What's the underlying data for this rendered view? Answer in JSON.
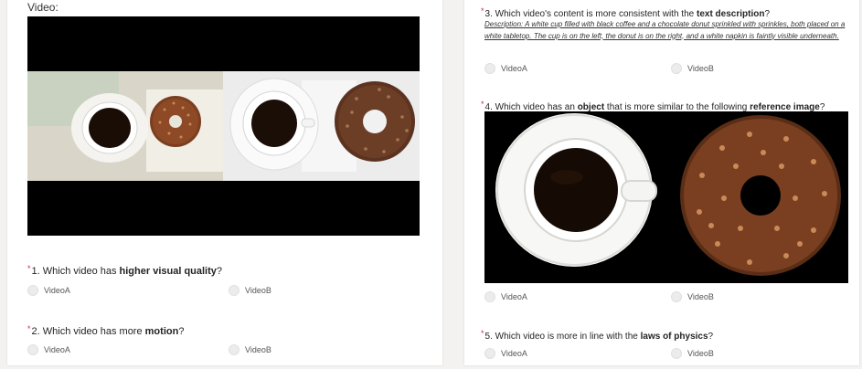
{
  "left": {
    "video_label": "Video:",
    "q1": {
      "num": "1.",
      "text_a": "Which video has ",
      "bold": "higher visual quality",
      "text_b": "?"
    },
    "q2": {
      "num": "2.",
      "text_a": "Which video has more ",
      "bold": "motion",
      "text_b": "?"
    },
    "option_a": "VideoA",
    "option_b": "VideoB"
  },
  "right": {
    "q3": {
      "num": "3.",
      "text_a": "Which video's content is more consistent with the ",
      "bold": "text description",
      "text_b": "?"
    },
    "description": "Description: A white cup filled with black coffee and a chocolate donut sprinkled with sprinkles, both placed on a white tabletop. The cup is on the left, the donut is on the right, and a white napkin is faintly visible underneath.",
    "q4": {
      "num": "4.",
      "text_a": "Which video has an ",
      "bold": "object",
      "text_mid": " that is more similar to the following ",
      "bold2": "reference image",
      "text_b": "?"
    },
    "q5": {
      "num": "5.",
      "text_a": "Which video is more in line with the ",
      "bold": "laws of physics",
      "text_b": "?"
    },
    "option_a": "VideoA",
    "option_b": "VideoB"
  },
  "colors": {
    "required_marker": "#c4314b",
    "radio_fill": "#ececec",
    "page_bg": "#f3f2f1"
  }
}
